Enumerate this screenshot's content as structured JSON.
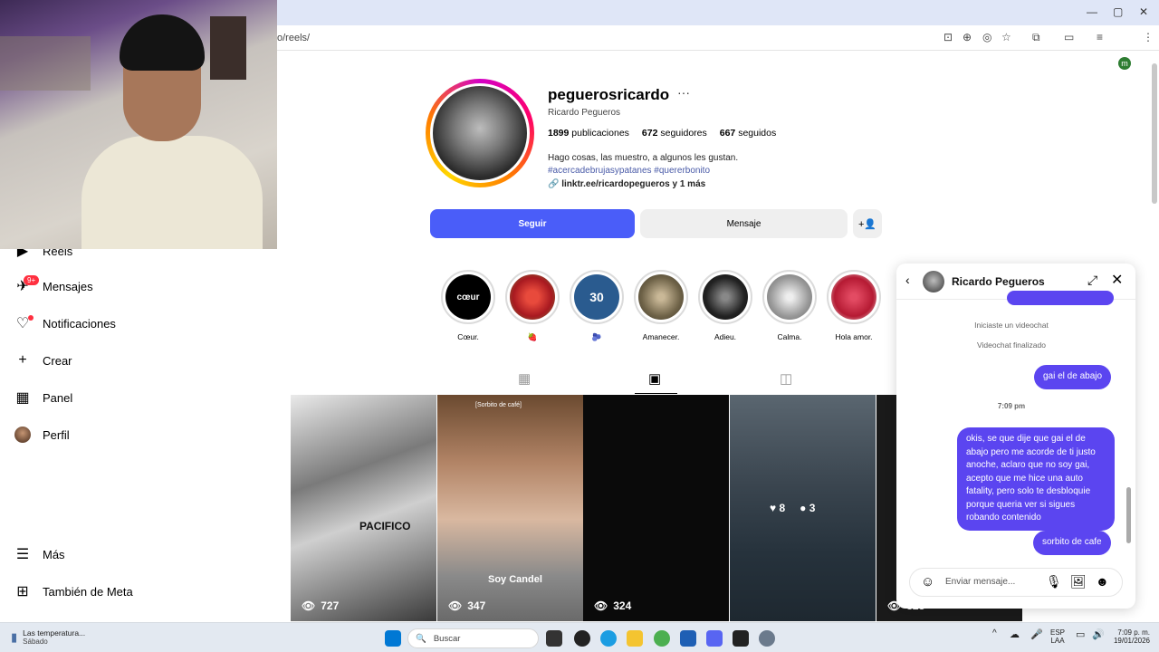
{
  "browser": {
    "url": "o/reels/",
    "window_controls": [
      "—",
      "▢",
      "✕"
    ]
  },
  "sidebar": {
    "items": [
      {
        "label": "Reels",
        "icon": "reels-icon"
      },
      {
        "label": "Mensajes",
        "icon": "messenger-icon",
        "badge": "9+"
      },
      {
        "label": "Notificaciones",
        "icon": "heart-icon"
      },
      {
        "label": "Crear",
        "icon": "plus-icon"
      },
      {
        "label": "Panel",
        "icon": "chart-icon"
      },
      {
        "label": "Perfil",
        "icon": "avatar"
      },
      {
        "label": "Más",
        "icon": "menu-icon"
      },
      {
        "label": "También de Meta",
        "icon": "grid-icon"
      }
    ]
  },
  "profile": {
    "username": "peguerosricardo",
    "more": "···",
    "full_name": "Ricardo Pegueros",
    "posts_count": "1899",
    "posts_label": "publicaciones",
    "followers_count": "672",
    "followers_label": "seguidores",
    "following_count": "667",
    "following_label": "seguidos",
    "bio": "Hago cosas, las muestro, a algunos les gustan.",
    "hashtags": "#acercadebrujasypatanes #quererbonito",
    "link": "linktr.ee/ricardopegueros y 1 más",
    "follow_button": "Seguir",
    "message_button": "Mensaje"
  },
  "highlights": [
    {
      "label": "Cœur.",
      "inner_text": "cœur",
      "color": "#000000"
    },
    {
      "label": "🍓",
      "color": "#c8202a"
    },
    {
      "label": "🫐",
      "inner_text": "30",
      "color": "#2a5b8f"
    },
    {
      "label": "Amanecer.",
      "color": "#8a7a5c"
    },
    {
      "label": "Adieu.",
      "color": "#2c2c2c"
    },
    {
      "label": "Calma.",
      "color": "#9a9a9a"
    },
    {
      "label": "Hola amor.",
      "color": "#c41f3a"
    }
  ],
  "reels": [
    {
      "views": "727",
      "bg": "#6a6a6a",
      "caption": "PACIFICO"
    },
    {
      "views": "347",
      "bg": "#8a6a55",
      "caption": "Soy Candel",
      "top_caption": "[Sorbito de café]"
    },
    {
      "views": "324",
      "bg": "#0a0a0a"
    },
    {
      "likes": "8",
      "comments": "3",
      "bg": "#3d4a55"
    },
    {
      "views": "323",
      "bg": "#1a1a1a"
    }
  ],
  "chat": {
    "contact": "Ricardo Pegueros",
    "messages": [
      {
        "type": "system",
        "text": "Iniciaste un videochat"
      },
      {
        "type": "system",
        "text": "Videochat finalizado"
      },
      {
        "type": "sent",
        "text": "gai el de abajo"
      },
      {
        "type": "time",
        "text": "7:09 pm"
      },
      {
        "type": "sent",
        "text": "okis, se que dije que gai el de abajo pero me acorde de ti justo anoche, aclaro que no soy gai, acepto que me hice una auto fatality, pero solo te desbloquie porque queria ver si sigues robando contenido"
      },
      {
        "type": "sent",
        "text": "sorbito de cafe"
      }
    ],
    "input_placeholder": "Enviar mensaje..."
  },
  "taskbar": {
    "weather_title": "Las temperatura...",
    "weather_sub": "Sábado",
    "search_label": "Buscar",
    "lang_top": "ESP",
    "lang_bottom": "LAA",
    "time": "7:09 p. m.",
    "date": "19/01/2026"
  },
  "colors": {
    "accent": "#4a5df9",
    "bubble": "#5b45f0",
    "notification": "#ff3040"
  }
}
